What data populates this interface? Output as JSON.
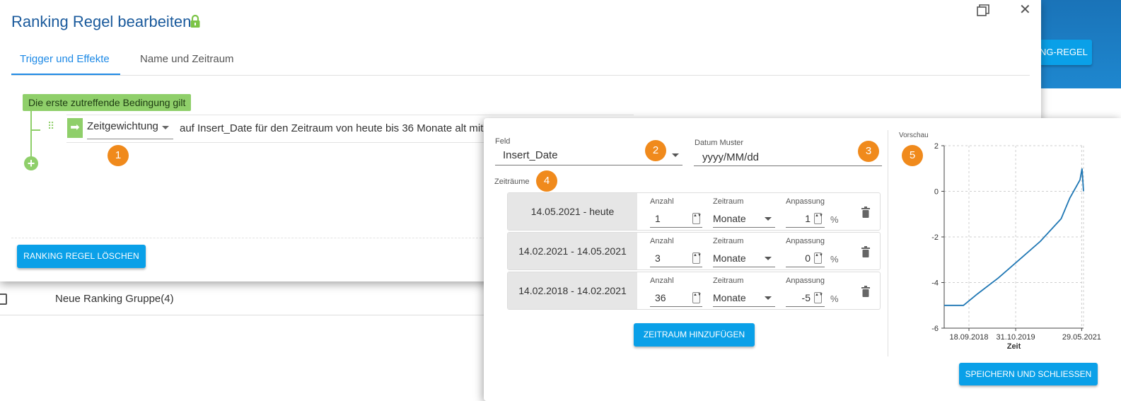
{
  "dialog": {
    "title": "Ranking Regel bearbeiten",
    "tabs": [
      {
        "label": "Trigger und Effekte",
        "active": true
      },
      {
        "label": "Name und Zeitraum",
        "active": false
      }
    ],
    "condition_badge": "Die erste zutreffende Bedingung gilt",
    "effect_select_value": "Zeitgewichtung",
    "rule_text": "auf Insert_Date für den Zeitraum von heute bis 36 Monate alt mit m",
    "delete_button": "RANKING REGEL LÖSCHEN"
  },
  "background": {
    "new_rule_button": "NG-REGEL",
    "row_label": "Neue Ranking Gruppe(4)"
  },
  "markers": [
    "1",
    "2",
    "3",
    "4",
    "5"
  ],
  "popover": {
    "field_label": "Feld",
    "field_value": "Insert_Date",
    "date_pattern_label": "Datum Muster",
    "date_pattern_value": "yyyy/MM/dd",
    "periods_label": "Zeiträume",
    "col_count_label": "Anzahl",
    "col_period_label": "Zeitraum",
    "col_adjust_label": "Anpassung",
    "percent_symbol": "%",
    "periods": [
      {
        "range": "14.05.2021 - heute",
        "count": "1",
        "unit": "Monate",
        "adjust": "1"
      },
      {
        "range": "14.02.2021 - 14.05.2021",
        "count": "3",
        "unit": "Monate",
        "adjust": "0"
      },
      {
        "range": "14.02.2018 - 14.02.2021",
        "count": "36",
        "unit": "Monate",
        "adjust": "-5"
      }
    ],
    "add_period_button": "ZEITRAUM HINZUFÜGEN",
    "preview_label": "Vorschau",
    "save_button": "SPEICHERN UND SCHLIESSEN"
  },
  "chart_data": {
    "type": "line",
    "title": "",
    "xlabel": "Zeit",
    "ylabel": "",
    "ylim": [
      -6,
      2
    ],
    "yticks": [
      "2",
      "0",
      "-2",
      "-4",
      "-6"
    ],
    "xticks": [
      "18.09.2018",
      "31.10.2019",
      "29.05.2021"
    ],
    "grid": true,
    "series": [
      {
        "color": "#1f77b4",
        "points": [
          {
            "x": "14.02.2018",
            "y": -5.0
          },
          {
            "x": "01.08.2018",
            "y": -5.0
          },
          {
            "x": "01.12.2018",
            "y": -4.5
          },
          {
            "x": "01.06.2019",
            "y": -3.8
          },
          {
            "x": "01.12.2019",
            "y": -3.0
          },
          {
            "x": "01.06.2020",
            "y": -2.2
          },
          {
            "x": "01.12.2020",
            "y": -1.2
          },
          {
            "x": "14.02.2021",
            "y": -0.3
          },
          {
            "x": "14.05.2021",
            "y": 0.5
          },
          {
            "x": "01.06.2021",
            "y": 1.0
          },
          {
            "x": "14.06.2021",
            "y": 0.0
          }
        ]
      }
    ]
  }
}
